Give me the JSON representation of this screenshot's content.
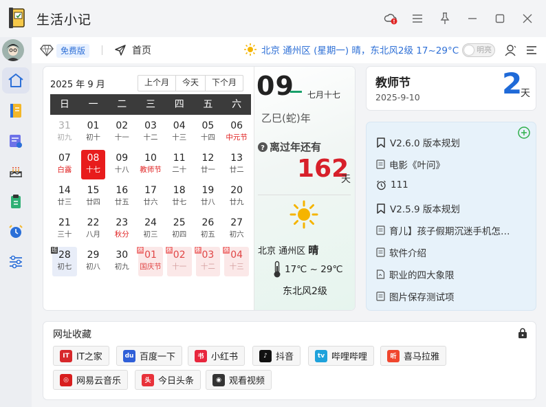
{
  "app": {
    "title": "生活小记"
  },
  "topbar": {
    "badge": "免费版",
    "home": "首页",
    "weather": "北京 通州区 (星期一) 晴，东北风2级 17~29°C",
    "toggle": "明亮"
  },
  "calendar": {
    "month_label": "2025 年 9 月",
    "nav": {
      "prev": "上个月",
      "today": "今天",
      "next": "下个月"
    },
    "weekdays": [
      "日",
      "一",
      "二",
      "三",
      "四",
      "五",
      "六"
    ],
    "weeks": [
      [
        {
          "d": "31",
          "l": "初九",
          "dim": true
        },
        {
          "d": "01",
          "l": "初十"
        },
        {
          "d": "02",
          "l": "十一"
        },
        {
          "d": "03",
          "l": "十二"
        },
        {
          "d": "04",
          "l": "十三"
        },
        {
          "d": "05",
          "l": "十四"
        },
        {
          "d": "06",
          "l": "中元节",
          "red": true
        }
      ],
      [
        {
          "d": "07",
          "l": "白露",
          "red": true
        },
        {
          "d": "08",
          "l": "十七",
          "today": true
        },
        {
          "d": "09",
          "l": "十八"
        },
        {
          "d": "10",
          "l": "教师节",
          "red": true
        },
        {
          "d": "11",
          "l": "二十"
        },
        {
          "d": "12",
          "l": "廿一"
        },
        {
          "d": "13",
          "l": "廿二"
        }
      ],
      [
        {
          "d": "14",
          "l": "廿三"
        },
        {
          "d": "15",
          "l": "廿四"
        },
        {
          "d": "16",
          "l": "廿五"
        },
        {
          "d": "17",
          "l": "廿六"
        },
        {
          "d": "18",
          "l": "廿七"
        },
        {
          "d": "19",
          "l": "廿八"
        },
        {
          "d": "20",
          "l": "廿九"
        }
      ],
      [
        {
          "d": "21",
          "l": "三十"
        },
        {
          "d": "22",
          "l": "八月"
        },
        {
          "d": "23",
          "l": "秋分",
          "red": true
        },
        {
          "d": "24",
          "l": "初三"
        },
        {
          "d": "25",
          "l": "初四"
        },
        {
          "d": "26",
          "l": "初五"
        },
        {
          "d": "27",
          "l": "初六"
        }
      ],
      [
        {
          "d": "28",
          "l": "初七",
          "hl": true,
          "tag": "班",
          "tagdark": true
        },
        {
          "d": "29",
          "l": "初八"
        },
        {
          "d": "30",
          "l": "初九"
        },
        {
          "d": "01",
          "l": "国庆节",
          "next": true,
          "tag": "休"
        },
        {
          "d": "02",
          "l": "十一",
          "next": true,
          "gray": true,
          "tag": "休"
        },
        {
          "d": "03",
          "l": "十二",
          "next": true,
          "gray": true,
          "tag": "休"
        },
        {
          "d": "04",
          "l": "十三",
          "next": true,
          "gray": true,
          "tag": "休"
        }
      ]
    ],
    "side": {
      "day": "09",
      "lunar": "七月十七",
      "ganzhi": "乙巳(蛇)年",
      "countdown_label": "离过年还有",
      "countdown_num": "162",
      "countdown_unit": "天",
      "location": "北京 通州区",
      "condition": "晴",
      "temp": "17℃ ~ 29℃",
      "wind": "东北风2级"
    }
  },
  "festival": {
    "name": "教师节",
    "date": "2025-9-10",
    "days": "2",
    "unit": "天"
  },
  "notes": [
    {
      "icon": "bookmark-icon",
      "text": "V2.6.0 版本规划"
    },
    {
      "icon": "note-icon",
      "text": "电影《叶问》"
    },
    {
      "icon": "alarm-icon",
      "text": "111"
    },
    {
      "icon": "bookmark-icon",
      "text": "V2.5.9 版本规划"
    },
    {
      "icon": "note-icon",
      "text": "育儿】孩子假期沉迷手机怎…"
    },
    {
      "icon": "note-icon",
      "text": "软件介绍"
    },
    {
      "icon": "document-icon",
      "text": "职业的四大象限"
    },
    {
      "icon": "note-icon",
      "text": "图片保存测试项"
    }
  ],
  "bookmarks": {
    "title": "网址收藏",
    "items": [
      {
        "label": "IT之家",
        "color": "#d7282b",
        "glyph": "IT"
      },
      {
        "label": "百度一下",
        "color": "#2f5fd8",
        "glyph": "du"
      },
      {
        "label": "小红书",
        "color": "#e8263d",
        "glyph": "书"
      },
      {
        "label": "抖音",
        "color": "#111111",
        "glyph": "♪"
      },
      {
        "label": "哔哩哔哩",
        "color": "#1fa2db",
        "glyph": "tv"
      },
      {
        "label": "喜马拉雅",
        "color": "#f0462e",
        "glyph": "听"
      },
      {
        "label": "网易云音乐",
        "color": "#d81e1e",
        "glyph": "◎"
      },
      {
        "label": "今日头条",
        "color": "#e8323a",
        "glyph": "头"
      },
      {
        "label": "观看视频",
        "color": "#333333",
        "glyph": "◉"
      }
    ]
  }
}
